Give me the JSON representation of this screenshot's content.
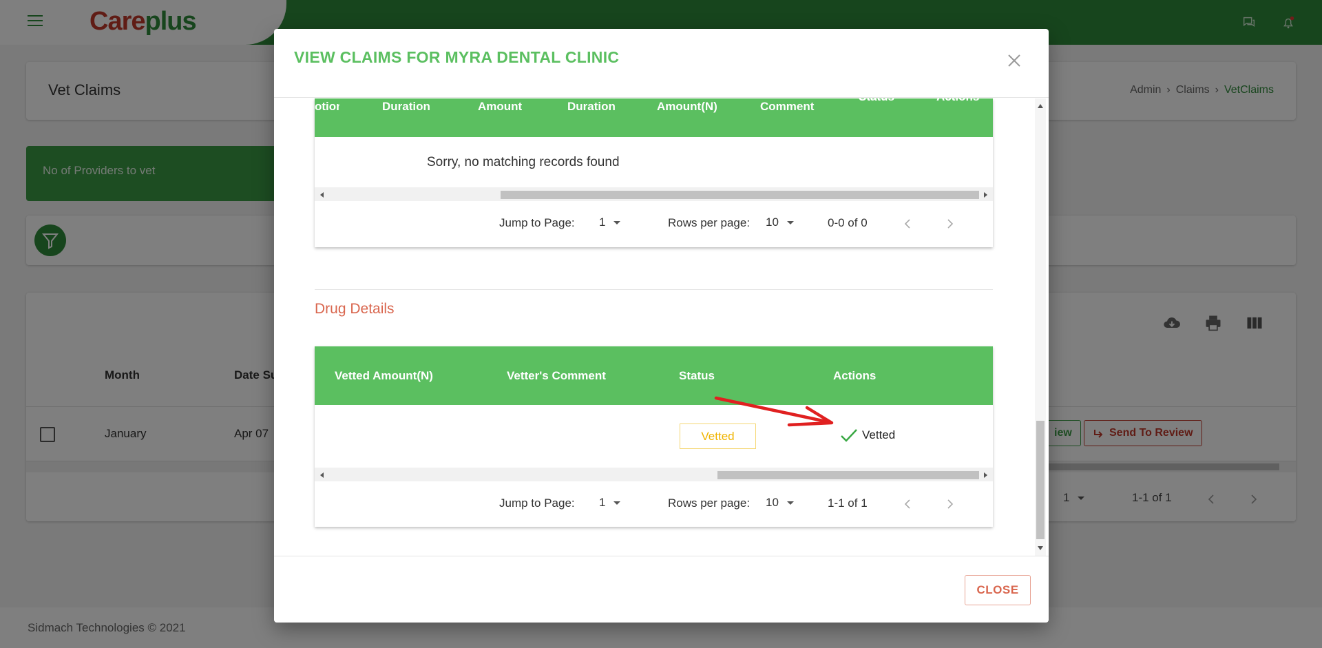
{
  "app": {
    "logo_primary": "Care",
    "logo_secondary": "plus"
  },
  "page": {
    "title": "Vet Claims",
    "breadcrumb": [
      "Admin",
      "Claims",
      "VetClaims"
    ]
  },
  "stats": {
    "providers_label": "No of Providers to vet"
  },
  "background_table": {
    "columns": [
      "Month",
      "Date Su"
    ],
    "row": {
      "month": "January",
      "date": "Apr 07"
    },
    "view_label": "iew",
    "send_to_review_label": "Send To Review",
    "page_value": "1",
    "range": "1-1 of 1"
  },
  "footer": {
    "copyright": "Sidmach Technologies © 2021"
  },
  "modal": {
    "title": "VIEW CLAIMS FOR MYRA DENTAL CLINIC",
    "close_label": "CLOSE",
    "services_table": {
      "columns": [
        "otion",
        "Duration",
        "Amount",
        "Duration",
        "Amount(N)",
        "Comment",
        "Status",
        "Actions"
      ],
      "empty_message": "Sorry, no matching records found",
      "pager": {
        "jump_label": "Jump to Page:",
        "page_value": "1",
        "rows_label": "Rows per page:",
        "rows_value": "10",
        "range": "0-0 of 0"
      }
    },
    "drug_section_title": "Drug Details",
    "drug_table": {
      "columns": [
        "Vetted Amount(N)",
        "Vetter's Comment",
        "Status",
        "Actions"
      ],
      "row": {
        "status": "Vetted",
        "action": "Vetted"
      },
      "pager": {
        "jump_label": "Jump to Page:",
        "page_value": "1",
        "rows_label": "Rows per page:",
        "rows_value": "10",
        "range": "1-1 of 1"
      }
    }
  },
  "colors": {
    "brand_green": "#2f8a3a",
    "header_green": "#5bbf60",
    "accent_red": "#d9664e",
    "status_yellow": "#f0b400",
    "annotation_red": "#e02020"
  }
}
